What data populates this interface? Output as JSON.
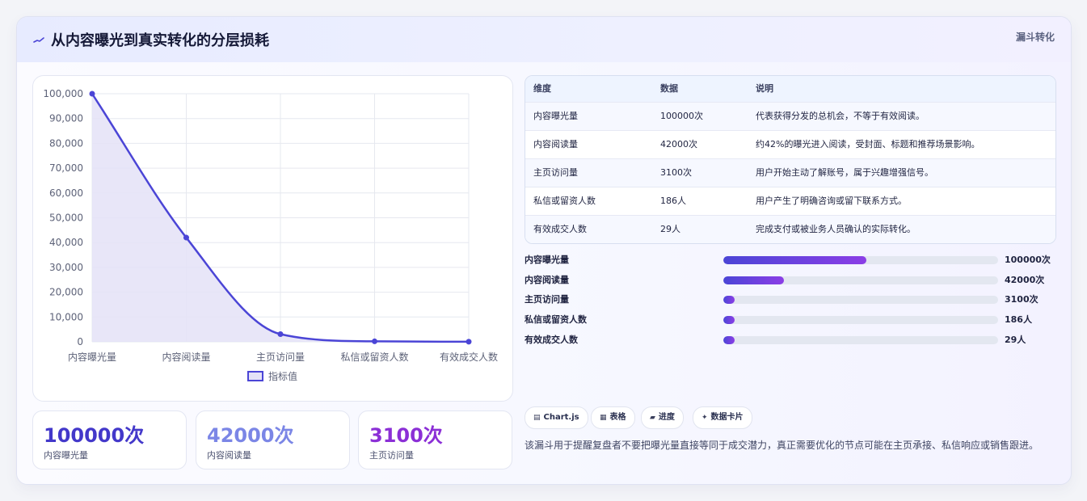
{
  "header": {
    "title": "从内容曝光到真实转化的分层损耗",
    "tag": "漏斗转化"
  },
  "chart_data": {
    "type": "line",
    "categories": [
      "内容曝光量",
      "内容阅读量",
      "主页访问量",
      "私信或留资人数",
      "有效成交人数"
    ],
    "series": [
      {
        "name": "指标值",
        "values": [
          100000,
          42000,
          3100,
          186,
          29
        ]
      }
    ],
    "ylim": [
      0,
      100000
    ],
    "yticks": [
      0,
      10000,
      20000,
      30000,
      40000,
      50000,
      60000,
      70000,
      80000,
      90000,
      100000
    ],
    "ytick_labels": [
      "0",
      "10,000",
      "20,000",
      "30,000",
      "40,000",
      "50,000",
      "60,000",
      "70,000",
      "80,000",
      "90,000",
      "100,000"
    ],
    "grid": true,
    "fill": true,
    "legend": "bottom",
    "line_color": "#4b45d6",
    "fill_color": "#e4e2f7"
  },
  "stats": [
    {
      "value": "100000次",
      "label": "内容曝光量",
      "color": "#4338ca"
    },
    {
      "value": "42000次",
      "label": "内容阅读量",
      "color": "#7b86e6"
    },
    {
      "value": "3100次",
      "label": "主页访问量",
      "color": "#8b2fd6"
    }
  ],
  "table": {
    "headers": [
      "维度",
      "数据",
      "说明"
    ],
    "rows": [
      [
        "内容曝光量",
        "100000次",
        "代表获得分发的总机会，不等于有效阅读。"
      ],
      [
        "内容阅读量",
        "42000次",
        "约42%的曝光进入阅读，受封面、标题和推荐场景影响。"
      ],
      [
        "主页访问量",
        "3100次",
        "用户开始主动了解账号，属于兴趣增强信号。"
      ],
      [
        "私信或留资人数",
        "186人",
        "用户产生了明确咨询或留下联系方式。"
      ],
      [
        "有效成交人数",
        "29人",
        "完成支付或被业务人员确认的实际转化。"
      ]
    ]
  },
  "progress": [
    {
      "label": "内容曝光量",
      "value": "100000次",
      "fraction": 0.52
    },
    {
      "label": "内容阅读量",
      "value": "42000次",
      "fraction": 0.22
    },
    {
      "label": "主页访问量",
      "value": "3100次",
      "fraction": 0.04
    },
    {
      "label": "私信或留资人数",
      "value": "186人",
      "fraction": 0.04
    },
    {
      "label": "有效成交人数",
      "value": "29人",
      "fraction": 0.04
    }
  ],
  "chips": [
    {
      "icon": "chart-icon",
      "glyph": "▤",
      "label": "Chart.js"
    },
    {
      "icon": "table-icon",
      "glyph": "▦",
      "label": "表格"
    },
    {
      "icon": "progress-icon",
      "glyph": "▰",
      "label": "进度"
    },
    {
      "icon": "sparkle-icon",
      "glyph": "✦",
      "label": "数据卡片"
    }
  ],
  "description": "该漏斗用于提醒复盘者不要把曝光量直接等同于成交潜力，真正需要优化的节点可能在主页承接、私信响应或销售跟进。"
}
